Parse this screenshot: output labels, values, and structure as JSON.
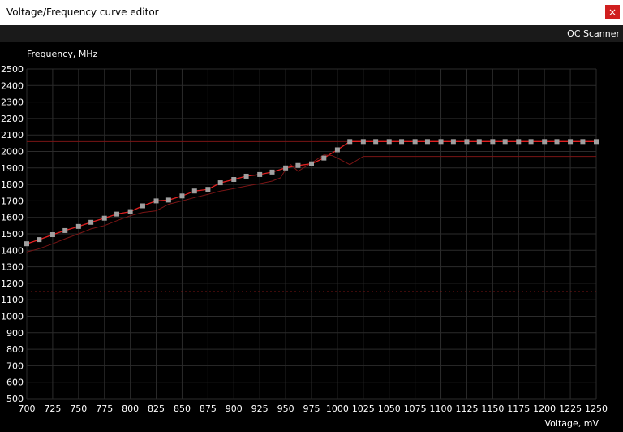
{
  "window": {
    "title": "Voltage/Frequency curve editor",
    "close_glyph": "×",
    "close_icon": "close-icon"
  },
  "toolbar": {
    "oc_scanner_label": "OC Scanner"
  },
  "colors": {
    "background": "#000000",
    "grid": "#2b2b2b",
    "curve": "#e02020",
    "reference_curve": "#7a1515",
    "point": "#a0a0a0",
    "close_button": "#d01f1f"
  },
  "chart_data": {
    "type": "line",
    "ylabel": "Frequency, MHz",
    "xlabel": "Voltage, mV",
    "xlim": [
      700,
      1250
    ],
    "ylim": [
      500,
      2500
    ],
    "xticks": [
      "700",
      "725",
      "750",
      "775",
      "800",
      "825",
      "850",
      "875",
      "900",
      "925",
      "950",
      "975",
      "1000",
      "1025",
      "1050",
      "1075",
      "1100",
      "1125",
      "1150",
      "1175",
      "1200",
      "1225",
      "1250"
    ],
    "yticks": [
      "500",
      "600",
      "700",
      "800",
      "900",
      "1000",
      "1100",
      "1200",
      "1300",
      "1400",
      "1500",
      "1600",
      "1700",
      "1800",
      "1900",
      "2000",
      "2100",
      "2200",
      "2300",
      "2400",
      "2500"
    ],
    "grid": true,
    "series": [
      {
        "role": "curve",
        "x": [
          700,
          712,
          725,
          737,
          750,
          762,
          775,
          787,
          800,
          812,
          825,
          837,
          850,
          862,
          875,
          887,
          900,
          912,
          925,
          937,
          950,
          962,
          975,
          987,
          1000,
          1012,
          1025,
          1037,
          1050,
          1062,
          1075,
          1087,
          1100,
          1112,
          1125,
          1137,
          1150,
          1162,
          1175,
          1187,
          1200,
          1212,
          1225,
          1237,
          1250
        ],
        "y": [
          1440,
          1465,
          1495,
          1520,
          1545,
          1570,
          1595,
          1620,
          1635,
          1670,
          1700,
          1705,
          1730,
          1760,
          1770,
          1810,
          1830,
          1850,
          1860,
          1875,
          1900,
          1915,
          1925,
          1960,
          2010,
          2060,
          2060,
          2060,
          2060,
          2060,
          2060,
          2060,
          2060,
          2060,
          2060,
          2060,
          2060,
          2060,
          2060,
          2060,
          2060,
          2060,
          2060,
          2060,
          2060
        ]
      },
      {
        "role": "reference",
        "x": [
          700,
          712,
          725,
          737,
          750,
          762,
          775,
          787,
          800,
          812,
          825,
          837,
          850,
          862,
          875,
          887,
          900,
          912,
          925,
          937,
          945,
          950,
          955,
          962,
          975,
          987,
          995,
          1000,
          1012,
          1025,
          1050,
          1100,
          1150,
          1200,
          1250
        ],
        "y": [
          1390,
          1410,
          1440,
          1470,
          1500,
          1530,
          1550,
          1580,
          1610,
          1630,
          1640,
          1680,
          1700,
          1720,
          1740,
          1760,
          1775,
          1790,
          1805,
          1820,
          1840,
          1890,
          1920,
          1880,
          1930,
          1980,
          1975,
          1960,
          1920,
          1970,
          1970,
          1970,
          1970,
          1970,
          1970
        ]
      }
    ],
    "points_x": [
      700,
      712,
      725,
      737,
      750,
      762,
      775,
      787,
      800,
      812,
      825,
      837,
      850,
      862,
      875,
      887,
      900,
      912,
      925,
      937,
      950,
      962,
      975,
      987,
      1000,
      1012,
      1025,
      1037,
      1050,
      1062,
      1075,
      1087,
      1100,
      1112,
      1125,
      1137,
      1150,
      1162,
      1175,
      1187,
      1200,
      1212,
      1225,
      1237,
      1250
    ],
    "target_line_y": 2060,
    "lower_line_y": 1990,
    "dotted_line_y": 1150
  }
}
